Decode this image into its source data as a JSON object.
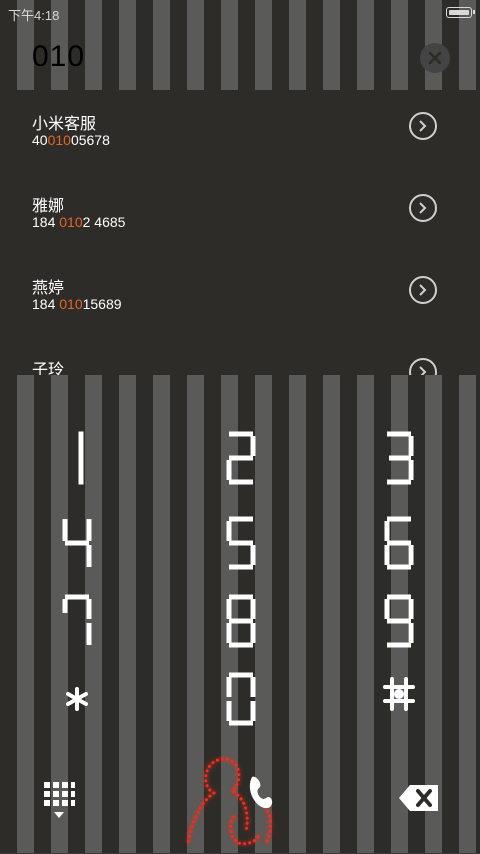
{
  "status": {
    "time": "下午4:18"
  },
  "search": {
    "query": "010"
  },
  "results": [
    {
      "name": "小米客服",
      "num_pre": "40",
      "num_hl": "010",
      "num_post": "05678"
    },
    {
      "name": "雅娜",
      "num_pre": "184 ",
      "num_hl": "010",
      "num_post": "2 4685"
    },
    {
      "name": "燕婷",
      "num_pre": "184 ",
      "num_hl": "010",
      "num_post": "15689"
    },
    {
      "name": "子玲",
      "num_pre": "",
      "num_hl": "",
      "num_post": ""
    }
  ],
  "keypad": {
    "keys": [
      "1",
      "2",
      "3",
      "4",
      "5",
      "6",
      "7",
      "8",
      "9",
      "*",
      "0",
      "#"
    ]
  },
  "icons": {
    "keypad_toggle": "grid-icon",
    "call": "call-person-icon",
    "backspace": "backspace-icon",
    "detail": "chevron-right-circle-icon",
    "clear": "close-circle-icon"
  },
  "colors": {
    "highlight": "#e8622a",
    "call_glow": "#ff2a1a"
  }
}
